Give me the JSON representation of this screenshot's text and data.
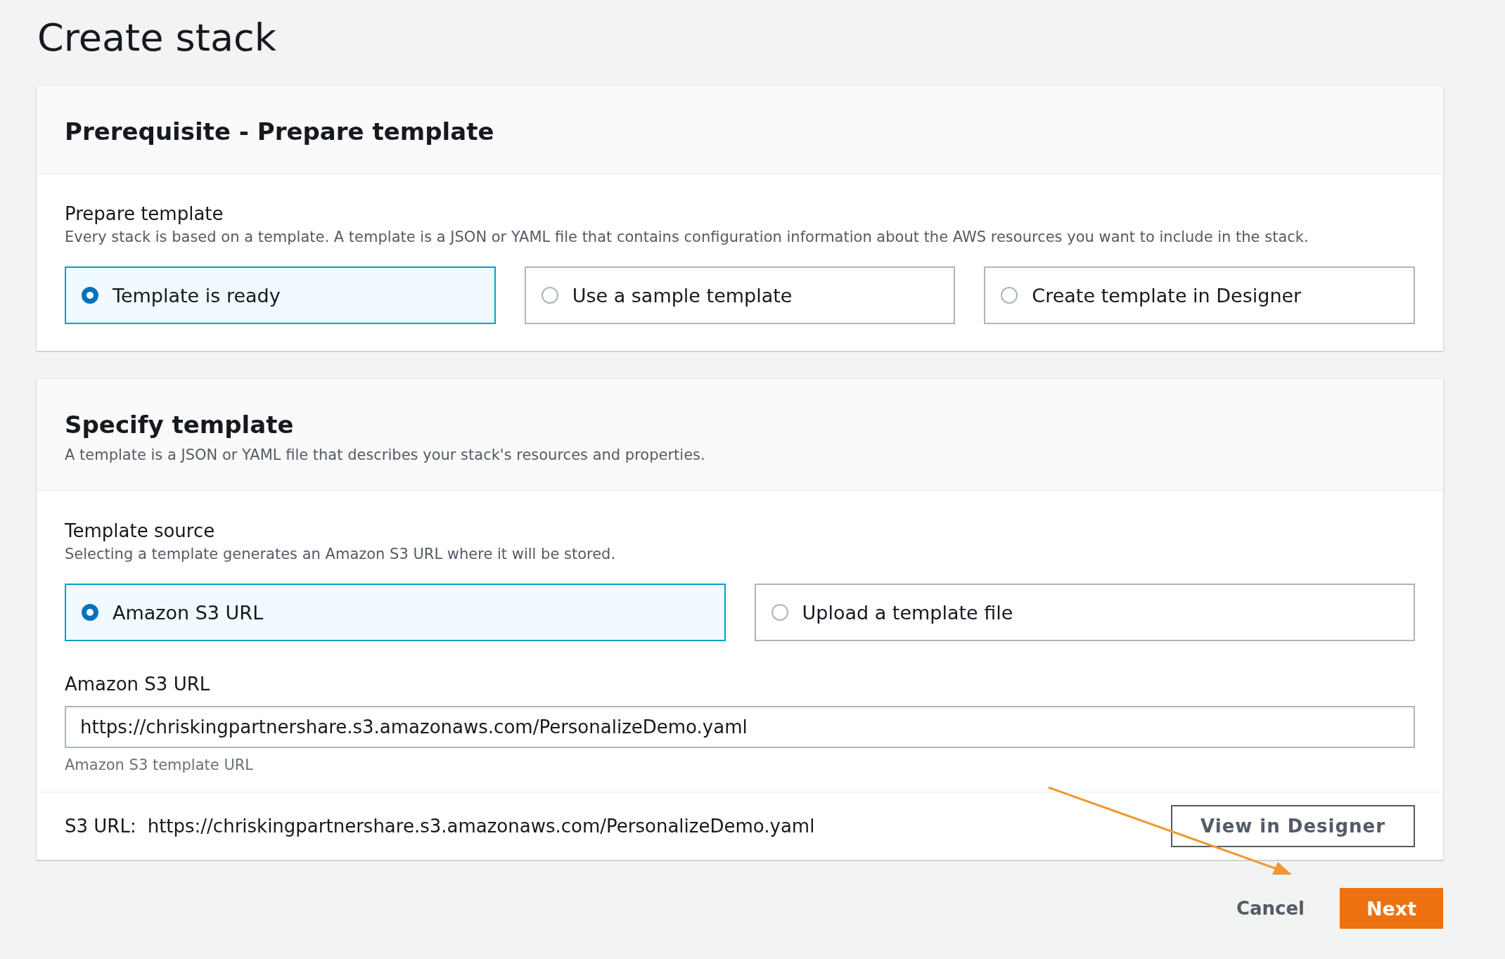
{
  "page_title": "Create stack",
  "prepare_section": {
    "title": "Prerequisite - Prepare template",
    "label": "Prepare template",
    "description": "Every stack is based on a template. A template is a JSON or YAML file that contains configuration information about the AWS resources you want to include in the stack.",
    "options": [
      {
        "label": "Template is ready",
        "selected": true
      },
      {
        "label": "Use a sample template",
        "selected": false
      },
      {
        "label": "Create template in Designer",
        "selected": false
      }
    ]
  },
  "specify_section": {
    "title": "Specify template",
    "description": "A template is a JSON or YAML file that describes your stack's resources and properties.",
    "label": "Template source",
    "source_description": "Selecting a template generates an Amazon S3 URL where it will be stored.",
    "options": [
      {
        "label": "Amazon S3 URL",
        "selected": true
      },
      {
        "label": "Upload a template file",
        "selected": false
      }
    ],
    "url_label": "Amazon S3 URL",
    "url_value": "https://chriskingpartnershare.s3.amazonaws.com/PersonalizeDemo.yaml",
    "url_hint": "Amazon S3 template URL",
    "footer_label": "S3 URL:",
    "footer_url": "https://chriskingpartnershare.s3.amazonaws.com/PersonalizeDemo.yaml",
    "designer_button": "View in Designer"
  },
  "actions": {
    "cancel": "Cancel",
    "next": "Next"
  }
}
